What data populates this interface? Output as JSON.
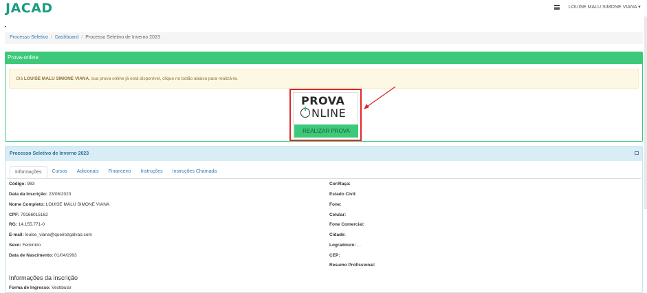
{
  "header": {
    "logo": "JACAD",
    "user_menu": "LOUISE MALU SIMONE VIANA ▾"
  },
  "breadcrumb": {
    "items": [
      "Processo Seletivo",
      "Dashboard",
      "Processo Seletivo de Inverno 2023"
    ]
  },
  "prova_panel": {
    "title": "Prova-online",
    "alert_prefix": "Olá ",
    "alert_name": "LOUISE MALU SIMONE VIANA",
    "alert_suffix": ", sua prova online já está disponível, clique no botão abaixo para realizá-la.",
    "logo_line1": "PROVA",
    "logo_line2": "NLINE",
    "button_label": "REALIZAR PROVA"
  },
  "process_panel": {
    "title": "Processo Seletivo de Inverno 2023",
    "tabs": [
      "Informações",
      "Cursos",
      "Adicionais",
      "Financeiro",
      "Instruções",
      "Instruções Chamada"
    ],
    "left_fields": [
      {
        "label": "Código:",
        "value": " 983"
      },
      {
        "label": "Data da Inscrição:",
        "value": " 23/06/2023"
      },
      {
        "label": "Nome Completo:",
        "value": " LOUISE MALU SIMONE VIANA"
      },
      {
        "label": "CPF:",
        "value": " 79166015162"
      },
      {
        "label": "RG:",
        "value": " 14.155.771-0"
      },
      {
        "label": "E-mail:",
        "value": " louise_viana@queirozgalvao.com"
      },
      {
        "label": "Sexo:",
        "value": " Feminino"
      },
      {
        "label": "Data de Nascimento:",
        "value": " 01/04/1993"
      }
    ],
    "right_fields": [
      {
        "label": "Cor/Raça:",
        "value": ""
      },
      {
        "label": "Estado Civil:",
        "value": ""
      },
      {
        "label": "Fone:",
        "value": ""
      },
      {
        "label": "Celular:",
        "value": ""
      },
      {
        "label": "Fone Comercial:",
        "value": ""
      },
      {
        "label": "Cidade:",
        "value": ""
      },
      {
        "label": "Logradouro:",
        "value": " , ."
      },
      {
        "label": "CEP:",
        "value": ""
      },
      {
        "label": "Resumo Profissional:",
        "value": ""
      }
    ],
    "section_title": "Informações da inscrição",
    "ingresso_label": "Forma de Ingresso:",
    "ingresso_value": " Vestibular"
  },
  "colors": {
    "brand": "#1c9c82",
    "green": "#3cc97a",
    "highlight": "#e0262a",
    "info_bg": "#d9edf7"
  }
}
